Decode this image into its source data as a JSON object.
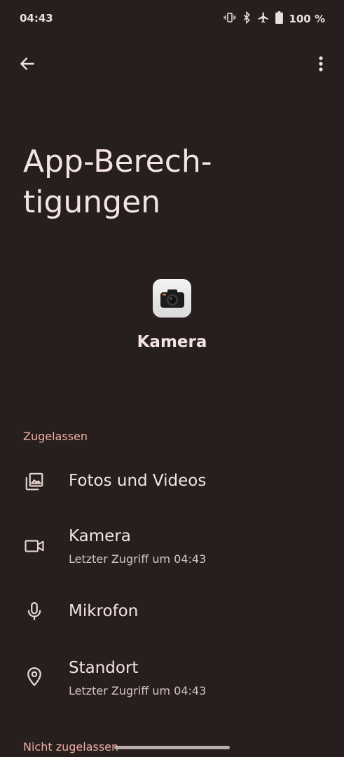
{
  "status_bar": {
    "time": "04:43",
    "battery": "100 %",
    "icons": [
      "vibrate-icon",
      "bluetooth-icon",
      "airplane-icon",
      "battery-icon"
    ]
  },
  "top_bar": {
    "back_icon": "arrow-back-icon",
    "more_icon": "more-vert-icon"
  },
  "page_title": "App-Berech-\ntigungen",
  "app": {
    "name": "Kamera",
    "icon": "camera-app-icon"
  },
  "sections": {
    "allowed_header": "Zugelassen",
    "denied_header": "Nicht zugelassen"
  },
  "permissions": [
    {
      "title": "Fotos und Videos",
      "subtitle": "",
      "icon": "photo-library-icon"
    },
    {
      "title": "Kamera",
      "subtitle": "Letzter Zugriff um 04:43",
      "icon": "videocam-icon"
    },
    {
      "title": "Mikrofon",
      "subtitle": "",
      "icon": "mic-icon"
    },
    {
      "title": "Standort",
      "subtitle": "Letzter Zugriff um 04:43",
      "icon": "location-icon"
    }
  ],
  "colors": {
    "background": "#261f1e",
    "accent": "#f1aea5",
    "text": "#f4e4e1"
  }
}
